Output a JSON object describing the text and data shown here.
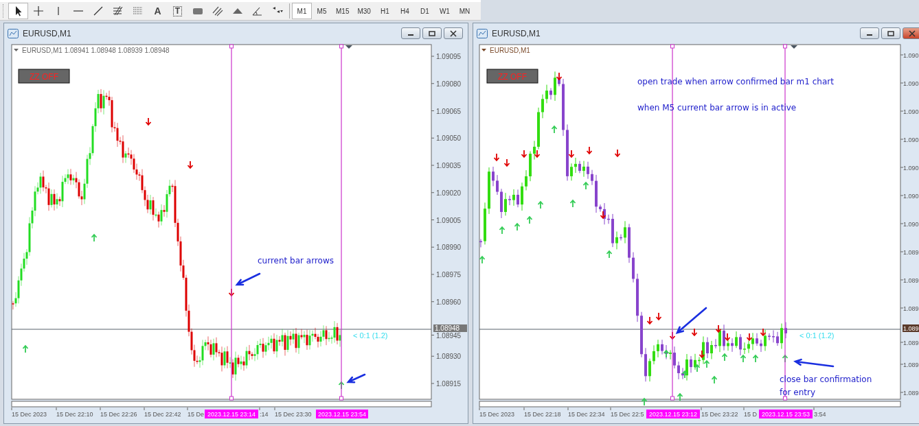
{
  "toolbar": {
    "tools": [
      {
        "kind": "cursor",
        "selected": true
      },
      {
        "kind": "crosshair",
        "selected": false
      },
      {
        "kind": "vline",
        "selected": false
      },
      {
        "kind": "hline",
        "selected": false
      },
      {
        "kind": "trendline",
        "selected": false
      },
      {
        "kind": "fibo",
        "selected": false
      },
      {
        "kind": "fibolines",
        "selected": false
      },
      {
        "kind": "text",
        "label": "A",
        "selected": false
      },
      {
        "kind": "textlabel",
        "label": "T",
        "selected": false
      },
      {
        "kind": "rect",
        "selected": false
      },
      {
        "kind": "channel",
        "selected": false
      },
      {
        "kind": "triangle",
        "selected": false
      },
      {
        "kind": "angle",
        "selected": false
      },
      {
        "kind": "more",
        "selected": false
      }
    ],
    "timeframes": [
      {
        "label": "M1",
        "selected": true
      },
      {
        "label": "M5",
        "selected": false
      },
      {
        "label": "M15",
        "selected": false
      },
      {
        "label": "M30",
        "selected": false
      },
      {
        "label": "H1",
        "selected": false
      },
      {
        "label": "H4",
        "selected": false
      },
      {
        "label": "D1",
        "selected": false
      },
      {
        "label": "W1",
        "selected": false
      },
      {
        "label": "MN",
        "selected": false
      }
    ]
  },
  "charts": [
    {
      "title": "EURUSD,M1",
      "header": "EURUSD,M1  1.08941 1.08948 1.08939 1.08948",
      "zz_button": "ZZ OFF",
      "price_labels": [
        "1.09095",
        "1.09080",
        "1.09065",
        "1.09050",
        "1.09035",
        "1.09020",
        "1.09005",
        "1.08990",
        "1.08975",
        "1.08960",
        "1.08945",
        "1.08930",
        "1.08915"
      ],
      "current_price": "1.08948",
      "ratio_label": "< 0:1 (1.2)",
      "time_labels": [
        "15 Dec 2023",
        "15 Dec 22:10",
        "15 Dec 22:26",
        "15 Dec 22:42",
        "15 De",
        ":14",
        "15 Dec 23:30"
      ],
      "marker_labels": [
        "2023.12.15 23:14",
        "2023.12.15 23:54"
      ],
      "notes": [
        "current bar arrows"
      ]
    },
    {
      "title": "EURUSD,M1",
      "header": "EURUSD,M1",
      "zz_button": "ZZ OFF",
      "price_labels": [
        "1.090",
        "1.090",
        "1.090",
        "1.090",
        "1.090",
        "1.090",
        "1.090",
        "1.089",
        "1.089",
        "1.089",
        "1.089",
        "1.089",
        "1.089"
      ],
      "current_price": "1.089",
      "ratio_label": "< 0:1 (1.2)",
      "time_labels": [
        "15 Dec 2023",
        "15 Dec 22:18",
        "15 Dec 22:34",
        "15 Dec 22:5",
        "15 Dec 23:22",
        "15 D",
        "3:54"
      ],
      "marker_labels": [
        "2023.12.15 23:12",
        "2023.12.15 23:53"
      ],
      "notes": [
        "open trade when arrow confirmed bar m1 chart",
        "when M5 current bar arrow is in active",
        "close bar confirmation",
        "for entry"
      ]
    }
  ]
}
